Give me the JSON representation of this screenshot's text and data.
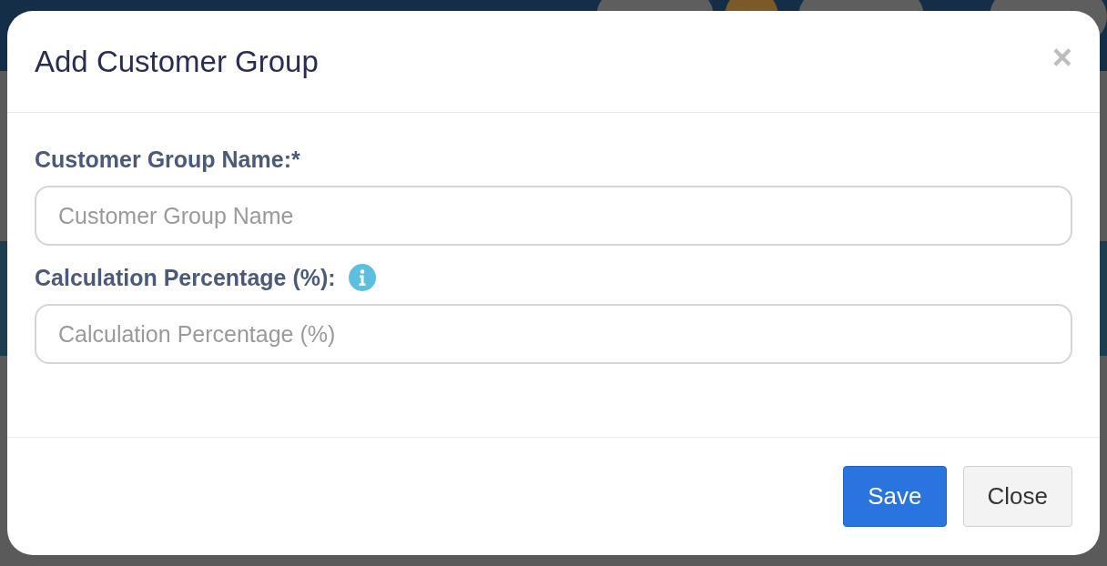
{
  "dialog": {
    "title": "Add Customer Group",
    "close_icon": "×"
  },
  "fields": [
    {
      "label": "Customer Group Name:*",
      "placeholder": "Customer Group Name",
      "info": false
    },
    {
      "label": "Calculation Percentage (%):",
      "placeholder": "Calculation Percentage (%)",
      "info": true
    }
  ],
  "buttons": [
    {
      "label": "Save",
      "kind": "primary"
    },
    {
      "label": "Close",
      "kind": "default"
    }
  ]
}
